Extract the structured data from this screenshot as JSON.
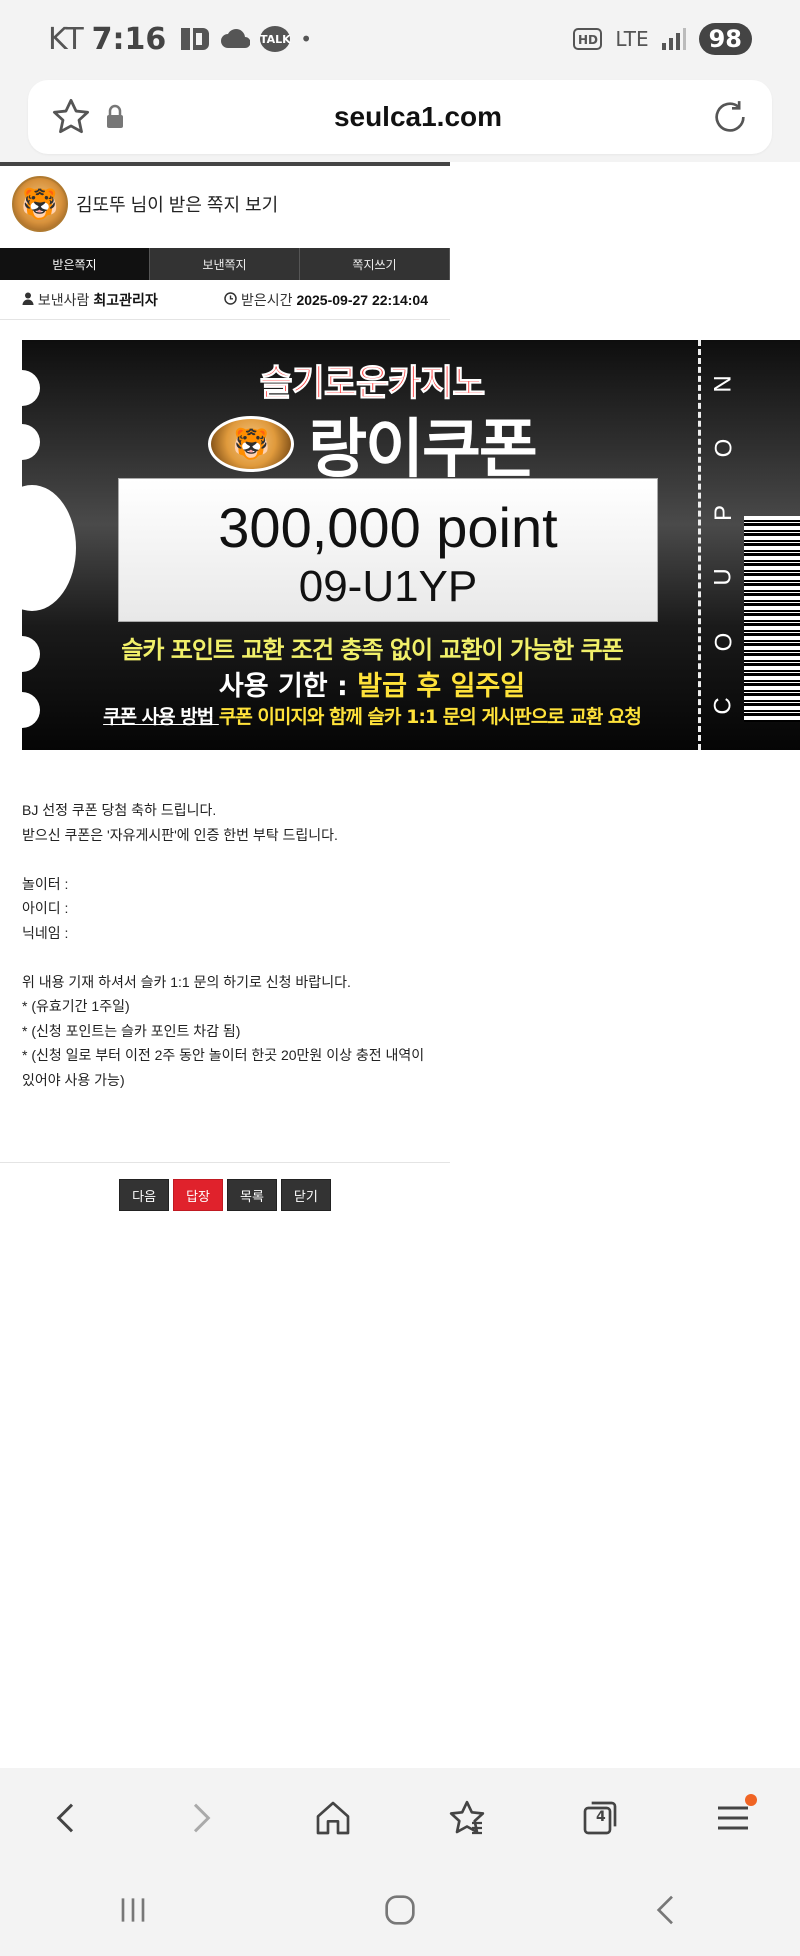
{
  "status_bar": {
    "carrier": "KT",
    "time": "7:16",
    "battery": "98",
    "network": "LTE",
    "hd": "HD",
    "kakao": "TALK"
  },
  "browser": {
    "url": "seulca1.com",
    "tab_count": "4"
  },
  "message": {
    "title": "김또뚜 님이 받은 쪽지 보기",
    "tabs": [
      "받은쪽지",
      "보낸쪽지",
      "쪽지쓰기"
    ],
    "sender_label": "보낸사람",
    "sender": "최고관리자",
    "time_label": "받은시간",
    "received_time": "2025-09-27 22:14:04",
    "body_lines": [
      "BJ 선정 쿠폰 당첨 축하 드립니다.",
      "받으신 쿠폰은 '자유게시판'에 인증 한번 부탁 드립니다.",
      "",
      "놀이터 :",
      "아이디 :",
      "닉네임 :",
      "",
      "위 내용 기재 하셔서 슬카 1:1 문의 하기로 신청 바랍니다.",
      "* (유효기간 1주일)",
      "* (신청 포인트는 슬카 포인트 차감 됨)",
      "* (신청 일로 부터 이전 2주 동안 놀이터 한곳 20만원 이상 충전 내역이",
      "있어야 사용 가능)"
    ],
    "buttons": [
      "다음",
      "답장",
      "목록",
      "닫기"
    ]
  },
  "coupon": {
    "brand": "슬기로운카지노",
    "name": "랑이쿠폰",
    "points": "300,000 point",
    "code": "09-U1YP",
    "line1": "슬카 포인트 교환 조건 충족 없이 교환이 가능한 쿠폰",
    "line2_label": "사용 기한 : ",
    "line2_value": "발급 후 일주일",
    "line3_label": "쿠폰 사용 방법 ",
    "line3_value": "쿠폰 이미지와 함께 슬카 1:1 문의 게시판으로 교환 요청",
    "side_letters": [
      "C",
      "O",
      "U",
      "P",
      "O",
      "N"
    ]
  }
}
